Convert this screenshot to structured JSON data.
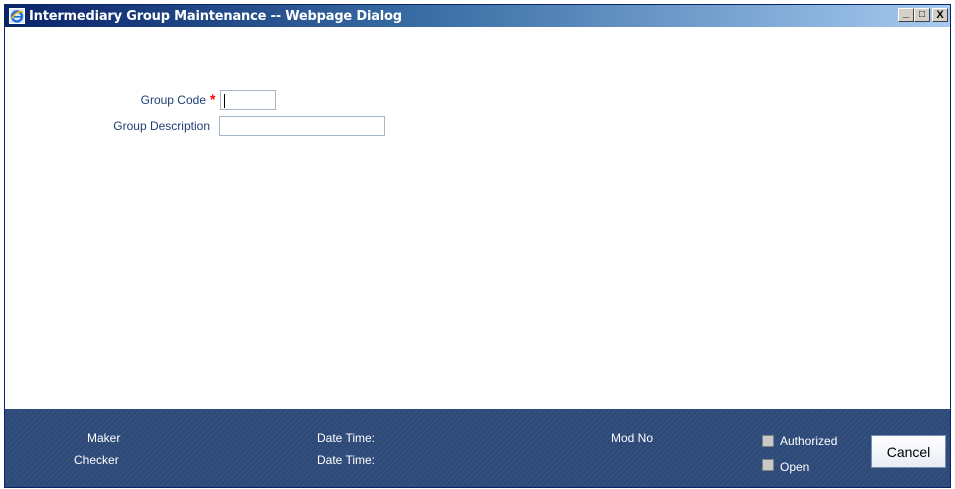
{
  "window": {
    "title": "Intermediary Group Maintenance -- Webpage Dialog",
    "controls": {
      "minimize": "_",
      "maximize": "□",
      "close": "X"
    }
  },
  "form": {
    "group_code": {
      "label": "Group Code",
      "required_marker": "*",
      "value": ""
    },
    "group_description": {
      "label": "Group Description",
      "value": ""
    }
  },
  "footer": {
    "maker_label": "Maker",
    "checker_label": "Checker",
    "maker_datetime_label": "Date Time:",
    "checker_datetime_label": "Date Time:",
    "mod_no_label": "Mod No",
    "authorized_label": "Authorized",
    "open_label": "Open",
    "cancel_label": "Cancel"
  },
  "colors": {
    "footer_bg": "#2d4a79",
    "label_text": "#1f3f75",
    "required": "#ff0000"
  }
}
